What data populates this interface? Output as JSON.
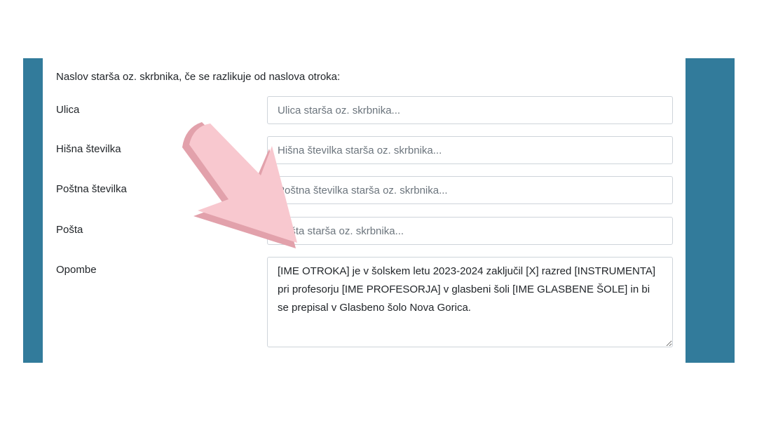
{
  "form": {
    "heading": "Naslov starša oz. skrbnika, če se razlikuje od naslova otroka:",
    "street": {
      "label": "Ulica",
      "placeholder": "Ulica starša oz. skrbnika..."
    },
    "house_number": {
      "label": "Hišna številka",
      "placeholder": "Hišna številka starša oz. skrbnika..."
    },
    "postal_code": {
      "label": "Poštna številka",
      "placeholder": "Poštna številka starša oz. skrbnika..."
    },
    "post_office": {
      "label": "Pošta",
      "placeholder": "Pošta starša oz. skrbnika..."
    },
    "notes": {
      "label": "Opombe",
      "value": "[IME OTROKA] je v šolskem letu 2023-2024 zaključil [X] razred [INSTRUMENTA] pri profesorju [IME PROFESORJA] v glasbeni šoli [IME GLASBENE ŠOLE] in bi se prepisal v Glasbeno šolo Nova Gorica."
    }
  },
  "colors": {
    "side_bar": "#327b9b",
    "arrow_fill": "#f8c8cf",
    "arrow_shadow": "#e2a1ab"
  },
  "icons": {
    "overlay": "pointing-arrow-icon"
  }
}
